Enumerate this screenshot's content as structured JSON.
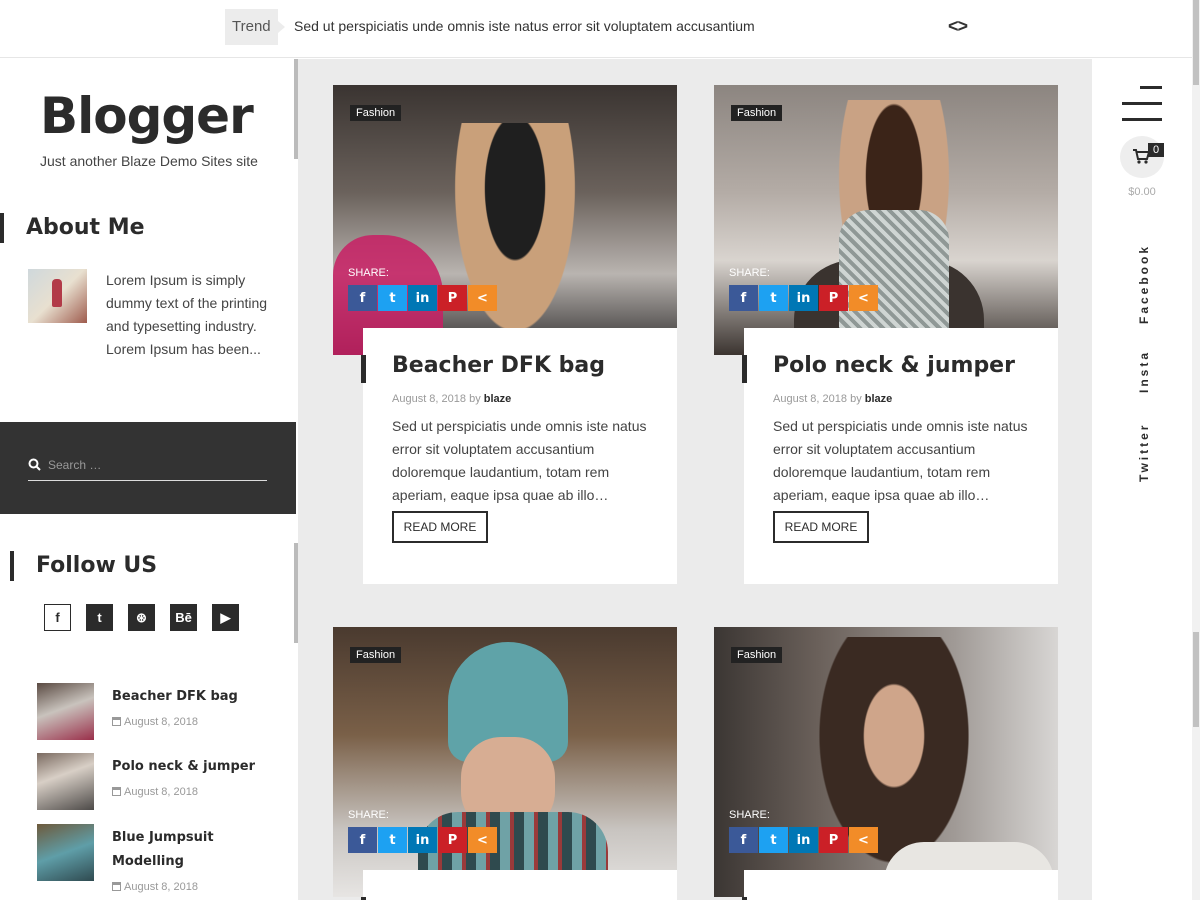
{
  "trending": {
    "label": "Trend",
    "headline": "Sed ut perspiciatis unde omnis iste natus error sit voluptatem accusantium",
    "nav": "<>"
  },
  "site": {
    "title": "Blogger",
    "tagline": "Just another Blaze Demo Sites site"
  },
  "sidebar": {
    "about": {
      "title": "About Me",
      "text": "Lorem Ipsum is simply dummy text of the printing and typesetting industry. Lorem Ipsum has been..."
    },
    "search": {
      "placeholder": "Search …"
    },
    "follow": {
      "title": "Follow US",
      "icons": [
        "facebook-icon",
        "twitter-icon",
        "dribbble-icon",
        "behance-icon",
        "youtube-icon"
      ],
      "glyphs": [
        "f",
        "t",
        "⊛",
        "Bē",
        "▶"
      ]
    },
    "recent": [
      {
        "title": "Beacher DFK bag",
        "date": "August 8, 2018"
      },
      {
        "title": "Polo neck & jumper",
        "date": "August 8, 2018"
      },
      {
        "title": "Blue Jumpsuit Modelling",
        "date": "August 8, 2018"
      }
    ]
  },
  "posts": [
    {
      "category": "Fashion",
      "share_label": "SHARE:",
      "title": "Beacher DFK bag",
      "date": "August 8, 2018",
      "by": "by",
      "author": "blaze",
      "excerpt": "Sed ut perspiciatis unde omnis iste natus error sit voluptatem accusantium doloremque laudantium, totam rem aperiam, eaque ipsa quae ab illo…",
      "read_more": "READ MORE"
    },
    {
      "category": "Fashion",
      "share_label": "SHARE:",
      "title": "Polo neck & jumper",
      "date": "August 8, 2018",
      "by": "by",
      "author": "blaze",
      "excerpt": "Sed ut perspiciatis unde omnis iste natus error sit voluptatem accusantium doloremque laudantium, totam rem aperiam, eaque ipsa quae ab illo…",
      "read_more": "READ MORE"
    },
    {
      "category": "Fashion",
      "share_label": "SHARE:"
    },
    {
      "category": "Fashion",
      "share_label": "SHARE:"
    }
  ],
  "share_glyphs": {
    "facebook": "f",
    "twitter": "t",
    "linkedin": "in",
    "pinterest": "P",
    "more": "<"
  },
  "rail": {
    "cart_count": "0",
    "cart_total": "$0.00",
    "links": [
      "Facebook",
      "Insta",
      "Twitter"
    ]
  },
  "colors": {
    "accent": "#2b2b2b",
    "main_bg": "#ebebeb",
    "facebook": "#3b5998",
    "twitter": "#1da1f2",
    "linkedin": "#0077b5",
    "pinterest": "#cb2027",
    "share_more": "#f28c28"
  }
}
